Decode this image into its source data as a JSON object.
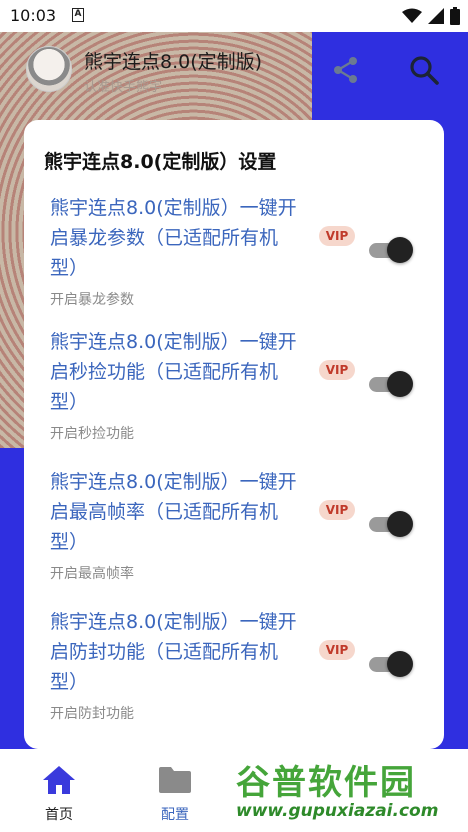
{
  "status_bar": {
    "time": "10:03",
    "notif_letter": "A"
  },
  "header": {
    "title": "熊宇连点8.0(定制版)",
    "author": "认准快手熊宇"
  },
  "dialog": {
    "title": "熊宇连点8.0(定制版）设置",
    "options": [
      {
        "label": "熊宇连点8.0(定制版）一键开启暴龙参数（已适配所有机型）",
        "sub": "开启暴龙参数",
        "badge": "VIP",
        "enabled": true
      },
      {
        "label": "熊宇连点8.0(定制版）一键开启秒捡功能（已适配所有机型）",
        "sub": "开启秒捡功能",
        "badge": "VIP",
        "enabled": true
      },
      {
        "label": "熊宇连点8.0(定制版）一键开启最高帧率（已适配所有机型）",
        "sub": "开启最高帧率",
        "badge": "VIP",
        "enabled": true
      },
      {
        "label": "熊宇连点8.0(定制版）一键开启防封功能（已适配所有机型）",
        "sub": "开启防封功能",
        "badge": "VIP",
        "enabled": true
      }
    ]
  },
  "bottom_nav": {
    "items": [
      {
        "label": "首页",
        "icon": "home-icon",
        "active": true
      },
      {
        "label": "配置",
        "icon": "folder-icon",
        "active": false
      }
    ]
  },
  "watermark": {
    "text": "谷普软件园",
    "url": "www.gupuxiazai.com"
  },
  "colors": {
    "accent": "#2f2fe0",
    "link_blue": "#3b66bd",
    "vip_bg": "#f6d7cc",
    "vip_text": "#c03a2a",
    "watermark_green": "#45a53a"
  }
}
